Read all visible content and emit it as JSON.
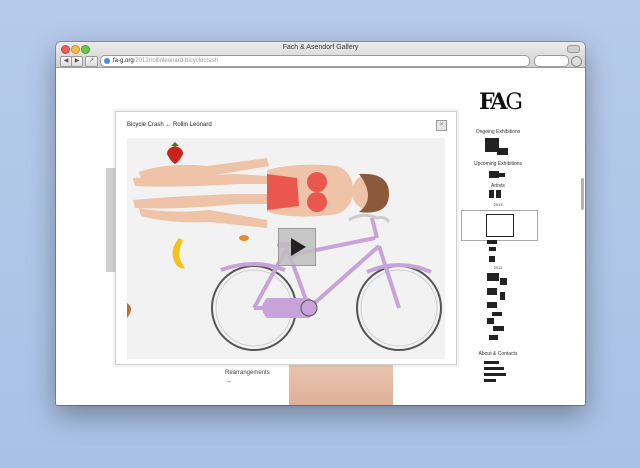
{
  "window": {
    "title": "Fach & Asendorf Gallery",
    "url_domain": "fa-g.org",
    "url_path": "/2012/rollinleonard-bicyclecrash"
  },
  "logo": {
    "text": "FA",
    "letter": "G"
  },
  "nav": {
    "ongoing": "Ongoing Exhibitions",
    "upcoming": "Upcoming Exhibitions",
    "artists": "Artists",
    "year1": "2013",
    "year2": "2011",
    "about": "About & Contacts"
  },
  "modal": {
    "title": "Bicycle Crash ← Rollin Leonard",
    "close": "×",
    "play": "▶"
  },
  "caption": {
    "text": "Rearrangements",
    "arrow": "→"
  },
  "colors": {
    "bike": "#c8a3d9",
    "bikini": "#e9574f",
    "skin": "#eec3a8",
    "strawberry": "#c8241c",
    "banana": "#f4c21b"
  }
}
